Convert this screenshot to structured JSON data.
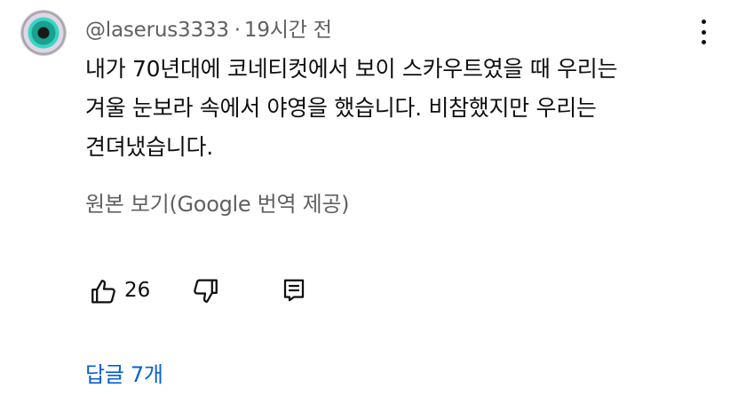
{
  "comment": {
    "author": "@laserus3333",
    "separator": "·",
    "time": "19시간 전",
    "lines": [
      "내가 70년대에 코네티컷에서 보이 스카우트였을 때 우리는",
      "겨울 눈보라 속에서 야영을 했습니다. 비참했지만 우리는",
      "견뎌냈습니다."
    ],
    "translation_label": "원본 보기(Google 번역 제공)",
    "like_count": "26",
    "replies_label": "답글 7개"
  },
  "icons": {
    "more": "more-vert-icon",
    "like": "thumb-up-icon",
    "dislike": "thumb-down-icon",
    "reply": "reply-icon"
  },
  "colors": {
    "text": "#0f0f0f",
    "secondary": "#606060",
    "link": "#065fd4"
  }
}
